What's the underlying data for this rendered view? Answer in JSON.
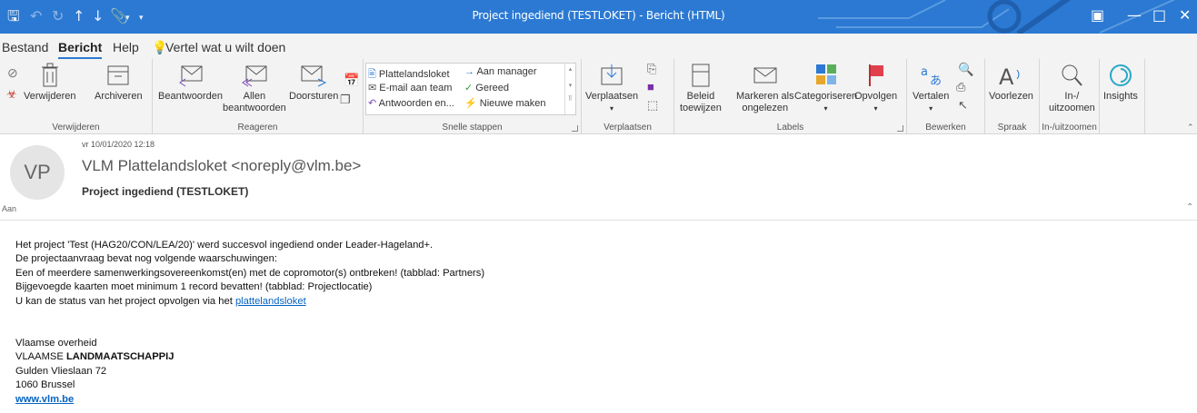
{
  "window": {
    "title": "Project ingediend (TESTLOKET)  -  Bericht (HTML)"
  },
  "quick_access": [
    "save-icon",
    "undo-icon",
    "redo-icon",
    "up-icon",
    "down-icon",
    "attach-icon",
    "dropdown-icon"
  ],
  "menu": {
    "tabs": [
      "Bestand",
      "Bericht",
      "Help"
    ],
    "active": "Bericht",
    "tellme": "Vertel wat u wilt doen"
  },
  "ribbon": {
    "groups": [
      {
        "label": "Verwijderen",
        "buttons": [
          "Verwijderen",
          "Archiveren"
        ]
      },
      {
        "label": "Reageren",
        "buttons": [
          "Beantwoorden",
          "Allen",
          "beantwoorden",
          "Doorsturen"
        ]
      },
      {
        "label": "Snelle stappen",
        "items": [
          "Plattelandsloket",
          "E-mail aan team",
          "Antwoorden en...",
          "Aan manager",
          "Gereed",
          "Nieuwe maken"
        ]
      },
      {
        "label": "Verplaatsen",
        "buttons": [
          "Verplaatsen"
        ]
      },
      {
        "label": "Labels",
        "buttons": [
          "Beleid",
          "toewijzen",
          "Markeren als",
          "ongelezen",
          "Categoriseren",
          "Opvolgen"
        ]
      },
      {
        "label": "Bewerken",
        "buttons": [
          "Vertalen"
        ]
      },
      {
        "label": "Spraak",
        "buttons": [
          "Voorlezen"
        ]
      },
      {
        "label": "In-/uitzoomen",
        "buttons": [
          "In-/",
          "uitzoomen"
        ]
      },
      {
        "label": "",
        "buttons": [
          "Insights"
        ]
      }
    ]
  },
  "message": {
    "date": "vr 10/01/2020 12:18",
    "avatar": "VP",
    "sender": "VLM Plattelandsloket <noreply@vlm.be>",
    "subject": "Project ingediend (TESTLOKET)",
    "to_label": "Aan",
    "body": [
      "Het project 'Test (HAG20/CON/LEA/20)' werd succesvol ingediend onder Leader-Hageland+.",
      "De projectaanvraag bevat nog volgende waarschuwingen:",
      "Een of meerdere samenwerkingsovereenkomst(en) met de copromotor(s) ontbreken! (tabblad: Partners)",
      "Bijgevoegde kaarten moet minimum 1 record bevatten! (tabblad: Projectlocatie)"
    ],
    "status_prefix": "U kan de status van het project opvolgen via het ",
    "status_link": "plattelandsloket",
    "signature": {
      "line1": "Vlaamse overheid",
      "org_prefix": "VLAAMSE ",
      "org_bold": "LANDMAATSCHAPPIJ",
      "street": "Gulden Vlieslaan 72",
      "city": "1060 Brussel",
      "website": "www.vlm.be"
    }
  }
}
